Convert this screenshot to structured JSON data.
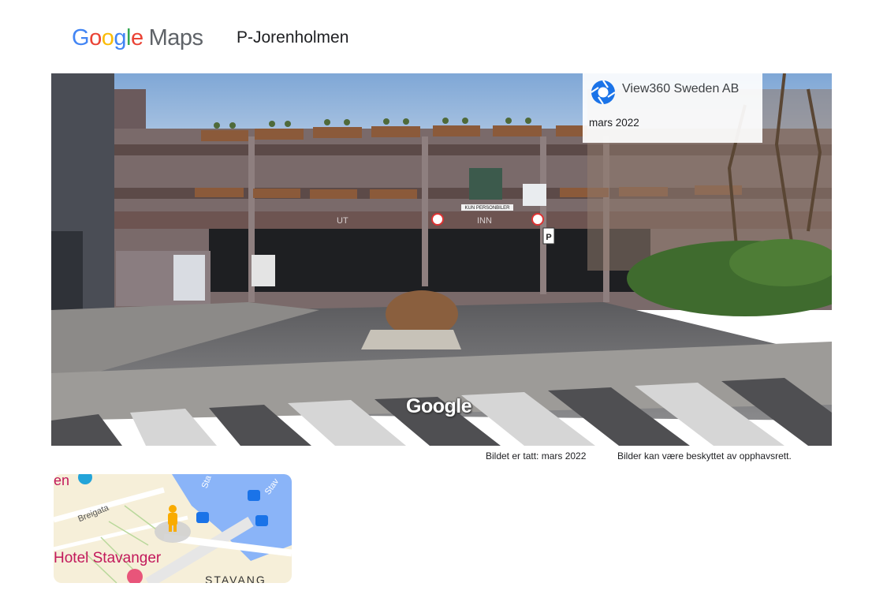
{
  "header": {
    "logo_google": "Google",
    "logo_maps": "Maps",
    "place_title": "P-Jorenholmen"
  },
  "pano": {
    "owner": "View360 Sweden AB",
    "capture_date": "mars 2022",
    "watermark": "Google",
    "sign_ut": "UT",
    "sign_inn": "INN",
    "sign_kun": "KUN PERSONBILER",
    "sign_p": "P"
  },
  "caption": {
    "taken": "Bildet er tatt: mars 2022",
    "copyright": "Bilder kan være beskyttet av opphavsrett."
  },
  "minimap": {
    "label_en": "en",
    "label_breigata": "Breigata",
    "label_hotel": "Hotel Stavanger",
    "label_stav1": "Sta",
    "label_stav2": "Stav",
    "label_stavanger": "STAVANG"
  },
  "colors": {
    "google_blue": "#4285F4",
    "google_red": "#EA4335",
    "google_yellow": "#FBBC05",
    "google_green": "#34A853",
    "water": "#8ab4f8",
    "land": "#f5f0e1",
    "pegman": "#f9ab00"
  }
}
